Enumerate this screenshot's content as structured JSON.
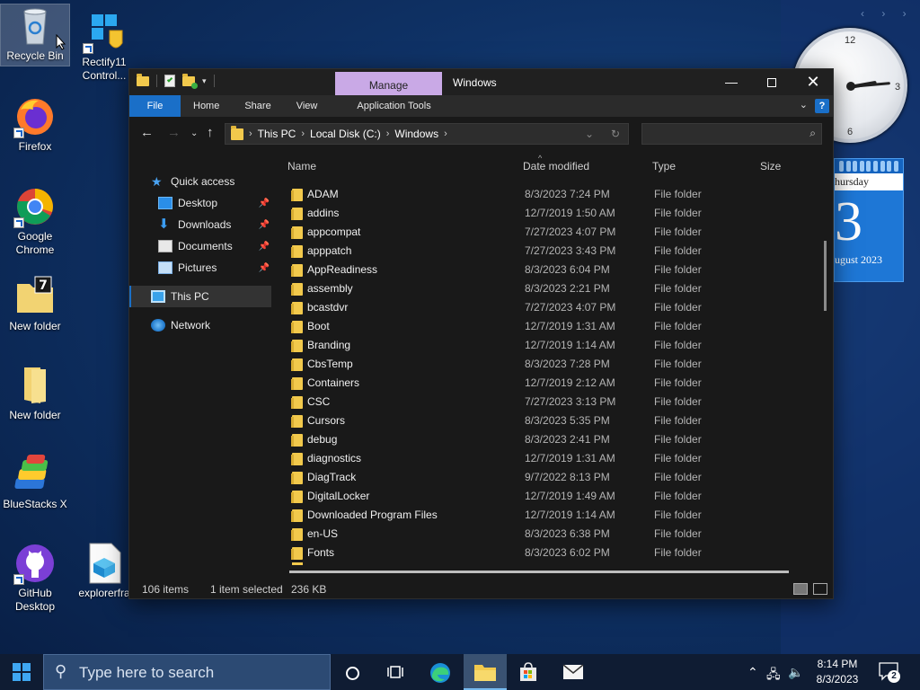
{
  "desktop": {
    "icons": [
      {
        "label": "Recycle Bin"
      },
      {
        "label": "Rectify11 Control..."
      },
      {
        "label": "Firefox"
      },
      {
        "label": "Google Chrome"
      },
      {
        "label": "New folder"
      },
      {
        "label": "New folder"
      },
      {
        "label": "BlueStacks X"
      },
      {
        "label": "GitHub Desktop"
      },
      {
        "label": "explorerfra"
      }
    ]
  },
  "gadgets": {
    "clock": {
      "n12": "12",
      "n3": "3",
      "n6": "6"
    },
    "calendar": {
      "day": "hursday",
      "date": "3",
      "month": "ugust 2023"
    }
  },
  "window": {
    "title": "Windows",
    "context_tab": "Manage",
    "ribbon_tabs": [
      "File",
      "Home",
      "Share",
      "View",
      "Application Tools"
    ],
    "help": "?",
    "path": [
      "This PC",
      "Local Disk (C:)",
      "Windows"
    ],
    "search_placeholder": "",
    "nav": {
      "quick_access": "Quick access",
      "desktop": "Desktop",
      "downloads": "Downloads",
      "documents": "Documents",
      "pictures": "Pictures",
      "this_pc": "This PC",
      "network": "Network"
    },
    "columns": {
      "name": "Name",
      "date": "Date modified",
      "type": "Type",
      "size": "Size"
    },
    "files": [
      {
        "name": "ADAM",
        "date": "8/3/2023 7:24 PM",
        "type": "File folder"
      },
      {
        "name": "addins",
        "date": "12/7/2019 1:50 AM",
        "type": "File folder"
      },
      {
        "name": "appcompat",
        "date": "7/27/2023 4:07 PM",
        "type": "File folder"
      },
      {
        "name": "apppatch",
        "date": "7/27/2023 3:43 PM",
        "type": "File folder"
      },
      {
        "name": "AppReadiness",
        "date": "8/3/2023 6:04 PM",
        "type": "File folder"
      },
      {
        "name": "assembly",
        "date": "8/3/2023 2:21 PM",
        "type": "File folder"
      },
      {
        "name": "bcastdvr",
        "date": "7/27/2023 4:07 PM",
        "type": "File folder"
      },
      {
        "name": "Boot",
        "date": "12/7/2019 1:31 AM",
        "type": "File folder"
      },
      {
        "name": "Branding",
        "date": "12/7/2019 1:14 AM",
        "type": "File folder"
      },
      {
        "name": "CbsTemp",
        "date": "8/3/2023 7:28 PM",
        "type": "File folder"
      },
      {
        "name": "Containers",
        "date": "12/7/2019 2:12 AM",
        "type": "File folder"
      },
      {
        "name": "CSC",
        "date": "7/27/2023 3:13 PM",
        "type": "File folder"
      },
      {
        "name": "Cursors",
        "date": "8/3/2023 5:35 PM",
        "type": "File folder"
      },
      {
        "name": "debug",
        "date": "8/3/2023 2:41 PM",
        "type": "File folder"
      },
      {
        "name": "diagnostics",
        "date": "12/7/2019 1:31 AM",
        "type": "File folder"
      },
      {
        "name": "DiagTrack",
        "date": "9/7/2022 8:13 PM",
        "type": "File folder"
      },
      {
        "name": "DigitalLocker",
        "date": "12/7/2019 1:49 AM",
        "type": "File folder"
      },
      {
        "name": "Downloaded Program Files",
        "date": "12/7/2019 1:14 AM",
        "type": "File folder"
      },
      {
        "name": "en-US",
        "date": "8/3/2023 6:38 PM",
        "type": "File folder"
      },
      {
        "name": "Fonts",
        "date": "8/3/2023 6:02 PM",
        "type": "File folder"
      }
    ],
    "status": {
      "items": "106 items",
      "selected": "1 item selected",
      "size": "236 KB"
    }
  },
  "taskbar": {
    "search_placeholder": "Type here to search",
    "time": "8:14 PM",
    "date": "8/3/2023",
    "notifications": "2"
  },
  "colors": {
    "accent": "#1a6fc8",
    "manage_tab": "#c9a9e6",
    "folder": "#f2c94c"
  }
}
